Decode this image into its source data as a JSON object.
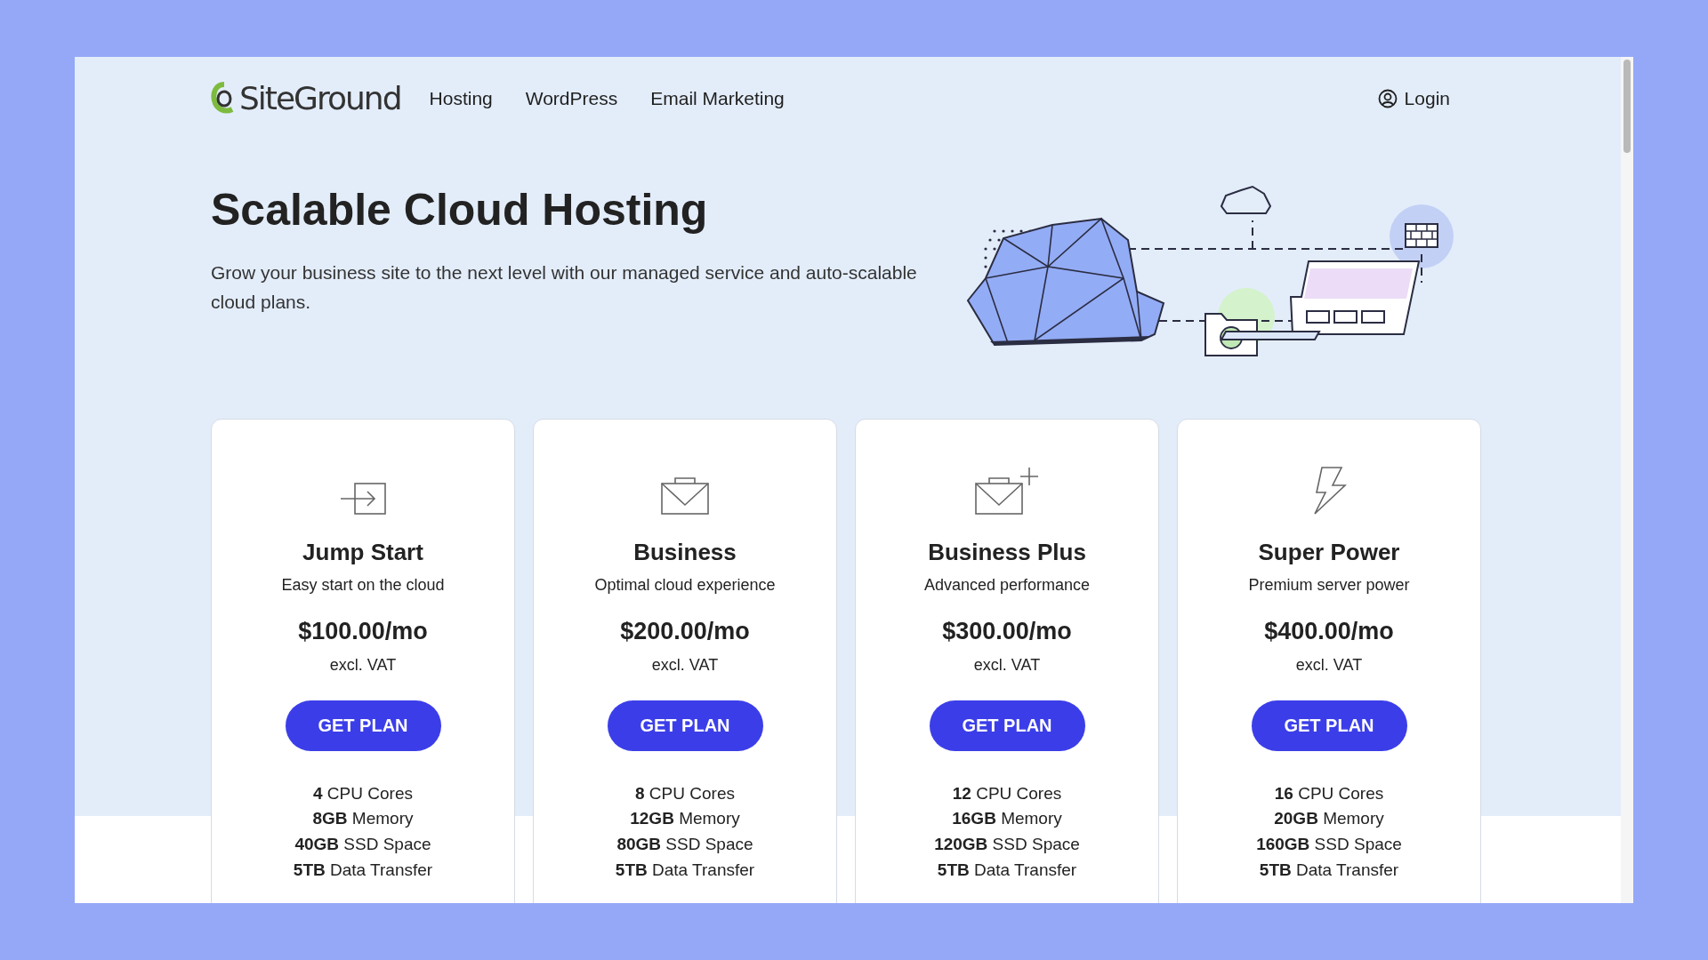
{
  "header": {
    "logo": "SiteGround",
    "nav": [
      "Hosting",
      "WordPress",
      "Email Marketing"
    ],
    "login": "Login"
  },
  "hero": {
    "title": "Scalable Cloud Hosting",
    "text": "Grow your business site to the next level with our managed service and auto-scalable cloud plans."
  },
  "plans": [
    {
      "kind": "jump",
      "name": "Jump Start",
      "tagline": "Easy start on the cloud",
      "price": "$100.00/mo",
      "tax": "excl. VAT",
      "button": "GET PLAN",
      "features": [
        "**4** CPU Cores",
        "**8GB** Memory",
        "**40GB** SSD Space",
        "**5TB** Data Transfer"
      ]
    },
    {
      "kind": "business",
      "name": "Business",
      "tagline": "Optimal cloud experience",
      "price": "$200.00/mo",
      "tax": "excl. VAT",
      "button": "GET PLAN",
      "features": [
        "**8** CPU Cores",
        "**12GB** Memory",
        "**80GB** SSD Space",
        "**5TB** Data Transfer"
      ]
    },
    {
      "kind": "business_plus",
      "name": "Business Plus",
      "tagline": "Advanced performance",
      "price": "$300.00/mo",
      "tax": "excl. VAT",
      "button": "GET PLAN",
      "features": [
        "**12** CPU Cores",
        "**16GB** Memory",
        "**120GB** SSD Space",
        "**5TB** Data Transfer"
      ]
    },
    {
      "kind": "power",
      "name": "Super Power",
      "tagline": "Premium server power",
      "price": "$400.00/mo",
      "tax": "excl. VAT",
      "button": "GET PLAN",
      "features": [
        "**16** CPU Cores",
        "**20GB** Memory",
        "**160GB** SSD Space",
        "**5TB** Data Transfer"
      ]
    }
  ]
}
